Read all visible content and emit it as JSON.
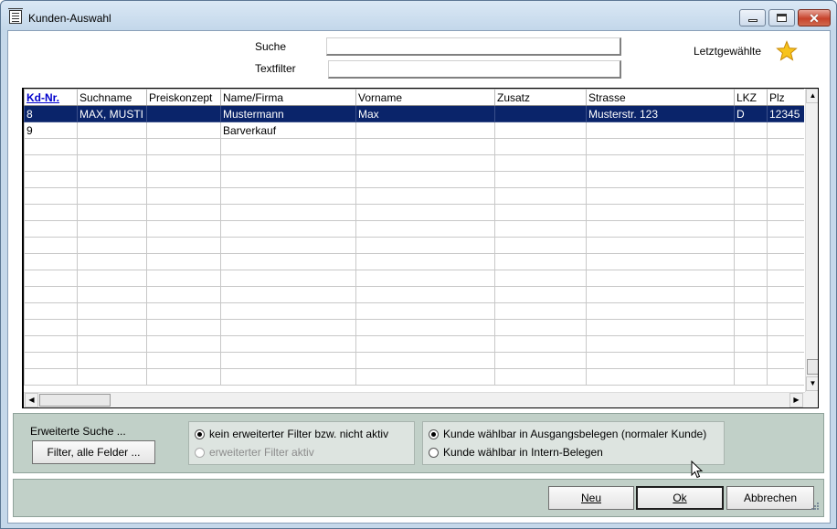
{
  "window": {
    "title": "Kunden-Auswahl"
  },
  "search": {
    "suche_label": "Suche",
    "suche_value": "",
    "textfilter_label": "Textfilter",
    "textfilter_value": "",
    "recent_label": "Letztgewählte",
    "recent_icon": "star-icon"
  },
  "table": {
    "columns": [
      "Kd-Nr.",
      "Suchname",
      "Preiskonzept",
      "Name/Firma",
      "Vorname",
      "Zusatz",
      "Strasse",
      "LKZ",
      "Plz"
    ],
    "sorted_column": "Kd-Nr.",
    "rows": [
      [
        "8",
        "MAX, MUSTI",
        "",
        "Mustermann",
        "Max",
        "",
        "Musterstr. 123",
        "D",
        "12345"
      ],
      [
        "9",
        "",
        "",
        "Barverkauf",
        "",
        "",
        "",
        "",
        ""
      ]
    ],
    "selected_row": 0
  },
  "extended_search": {
    "label": "Erweiterte Suche ...",
    "filter_button": "Filter, alle Felder ...",
    "filter_options": [
      {
        "label": "kein erweiterter Filter bzw. nicht aktiv",
        "checked": true,
        "enabled": true
      },
      {
        "label": "erweiterter Filter aktiv",
        "checked": false,
        "enabled": false
      }
    ],
    "customer_options": [
      {
        "label": "Kunde wählbar in Ausgangsbelegen (normaler Kunde)",
        "checked": true
      },
      {
        "label": "Kunde wählbar in Intern-Belegen",
        "checked": false
      }
    ]
  },
  "buttons": {
    "new": "Neu",
    "ok": "Ok",
    "cancel": "Abbrechen"
  },
  "colors": {
    "selection": "#0a246a",
    "panel": "#c1d0c8",
    "title_bar": "#c5d8ea",
    "close_button": "#c7432b"
  }
}
